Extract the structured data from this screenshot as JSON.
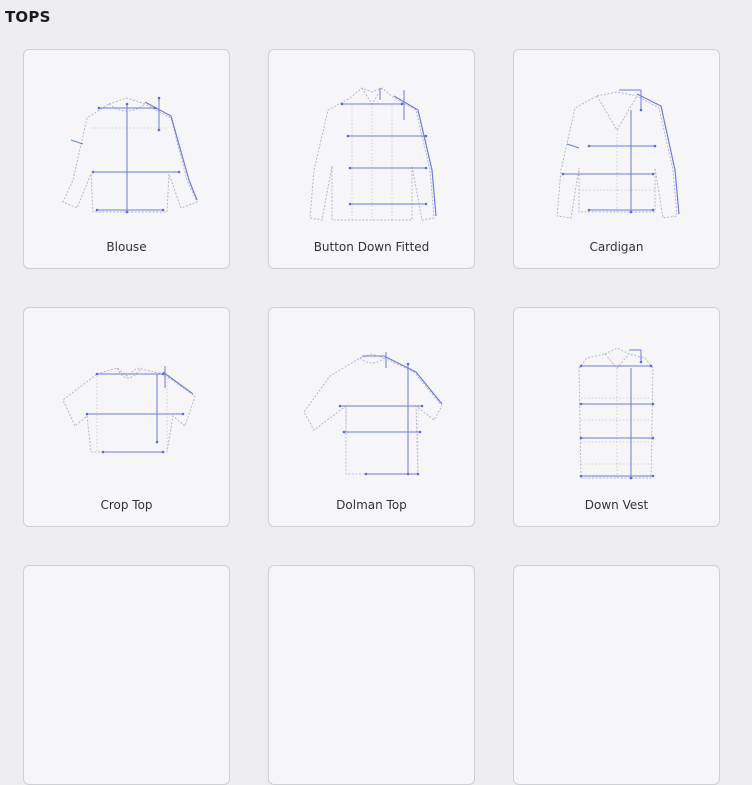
{
  "section": {
    "title": "TOPS"
  },
  "colors": {
    "background": "#eeeef0",
    "card_background": "#f6f6f9",
    "card_border": "#cfd0d6",
    "measurement_line": "#6f7be0"
  },
  "garments": [
    {
      "id": "blouse",
      "label": "Blouse",
      "icon": "blouse-icon"
    },
    {
      "id": "button-down-fitted",
      "label": "Button Down Fitted",
      "icon": "button-down-shirt-icon"
    },
    {
      "id": "cardigan",
      "label": "Cardigan",
      "icon": "cardigan-icon"
    },
    {
      "id": "crop-top",
      "label": "Crop Top",
      "icon": "crop-top-icon"
    },
    {
      "id": "dolman-top",
      "label": "Dolman Top",
      "icon": "dolman-top-icon"
    },
    {
      "id": "down-vest",
      "label": "Down Vest",
      "icon": "down-vest-icon"
    },
    {
      "id": "row3-col1",
      "label": "",
      "icon": "garment-icon"
    },
    {
      "id": "row3-col2",
      "label": "",
      "icon": "garment-icon"
    },
    {
      "id": "row3-col3",
      "label": "",
      "icon": "garment-icon"
    }
  ]
}
